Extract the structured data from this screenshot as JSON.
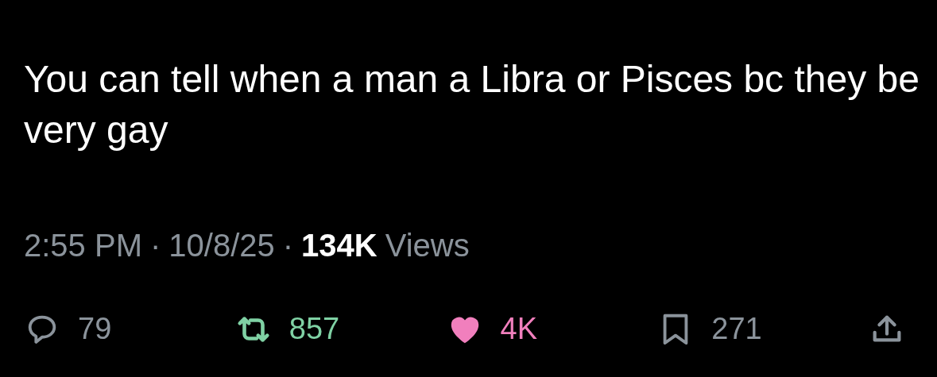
{
  "tweet": {
    "text": "You can tell when a man a Libra or Pisces bc they be very gay"
  },
  "meta": {
    "time": "2:55 PM",
    "separator_1": "·",
    "date": "10/8/25",
    "separator_2": "·",
    "views_count": "134K",
    "views_label": "Views"
  },
  "actions": [
    {
      "kind": "reply",
      "count": "79",
      "active": false
    },
    {
      "kind": "repost",
      "count": "857",
      "active": true
    },
    {
      "kind": "like",
      "count": "4K",
      "active": true
    },
    {
      "kind": "bookmark",
      "count": "271",
      "active": false
    },
    {
      "kind": "share",
      "active": false
    }
  ]
}
